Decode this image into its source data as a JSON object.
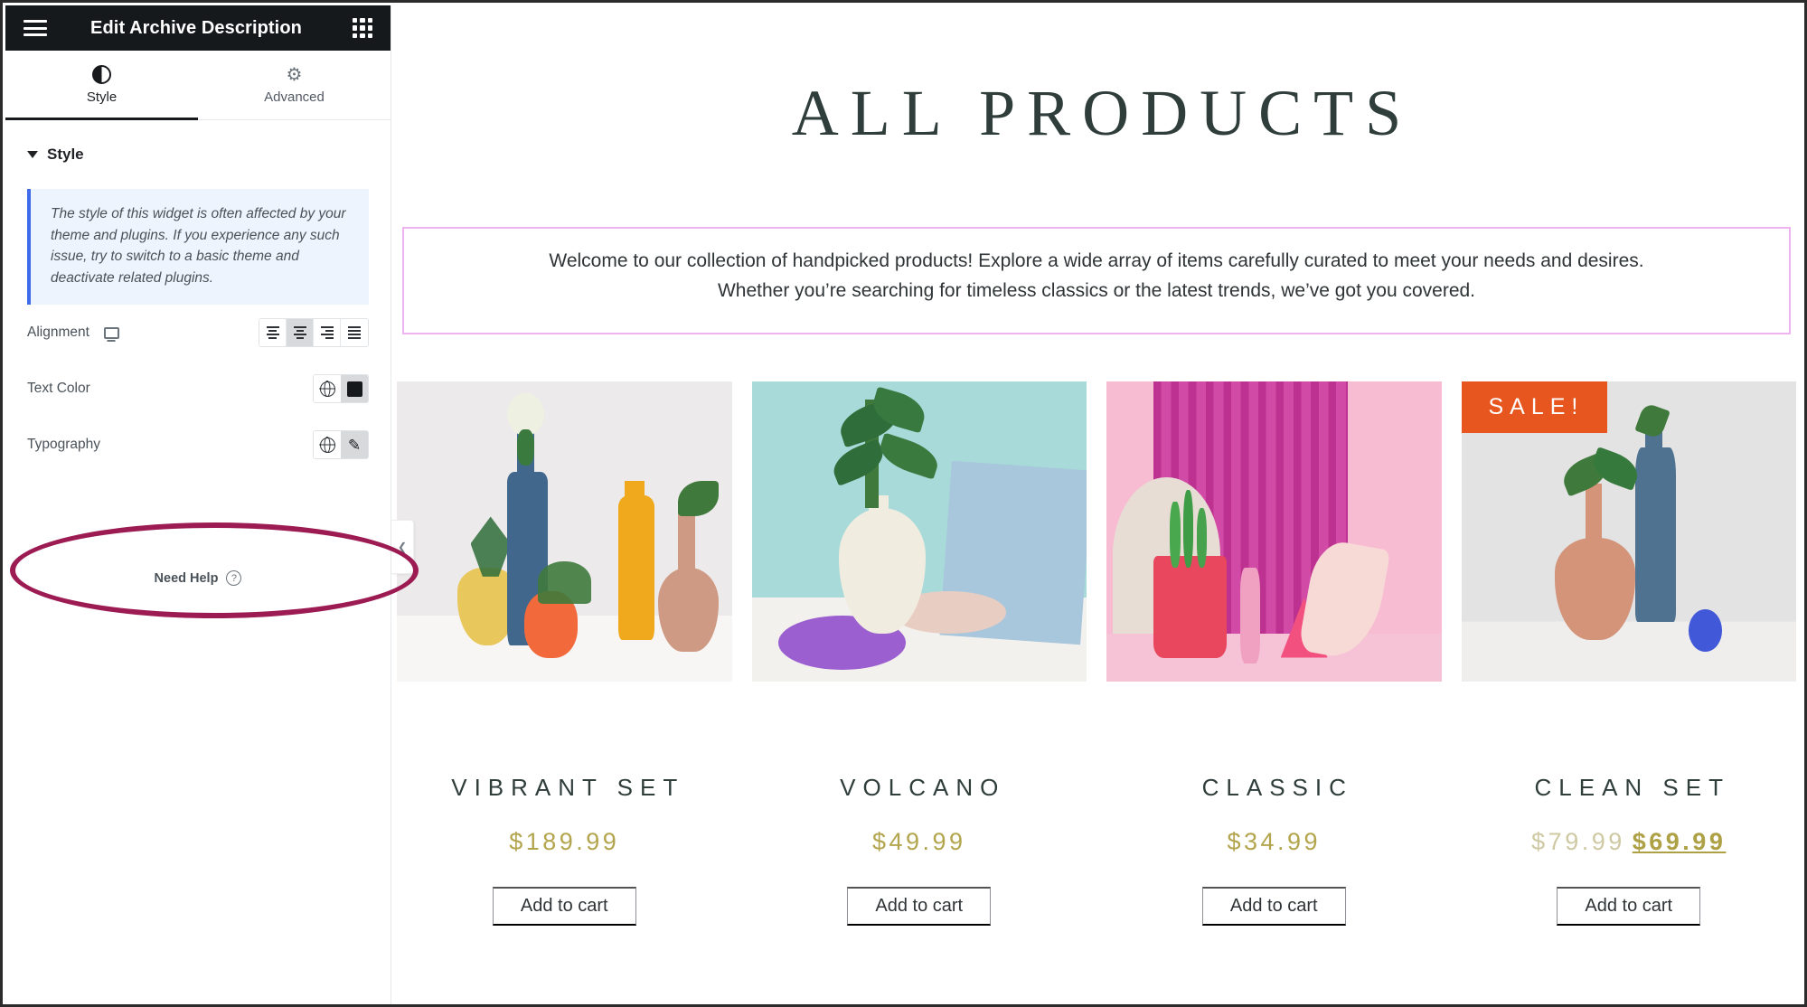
{
  "panel": {
    "header": {
      "title": "Edit Archive Description",
      "menu_icon": "hamburger-icon",
      "apps_icon": "grid-apps-icon"
    },
    "tabs": [
      {
        "label": "Style",
        "icon": "contrast-icon",
        "active": true
      },
      {
        "label": "Advanced",
        "icon": "gear-icon",
        "active": false
      }
    ],
    "section": {
      "title": "Style"
    },
    "notice": "The style of this widget is often affected by your theme and plugins. If you experience any such issue, try to switch to a basic theme and deactivate related plugins.",
    "controls": {
      "alignment": {
        "label": "Alignment",
        "device_icon": "monitor-icon",
        "options": [
          "align-left",
          "align-center",
          "align-right",
          "align-justify"
        ],
        "selected": "align-center"
      },
      "text_color": {
        "label": "Text Color",
        "globe_icon": "globe-icon",
        "swatch": "#16191c"
      },
      "typography": {
        "label": "Typography",
        "globe_icon": "globe-icon",
        "edit_icon": "pencil-icon"
      }
    },
    "need_help": {
      "label": "Need Help",
      "icon": "question-circle-icon"
    },
    "handle_icon": "collapse-arrow-icon",
    "annotation": {
      "shape": "ellipse",
      "color": "#9c1b52",
      "targets": "typography-row"
    }
  },
  "canvas": {
    "page_title": "ALL PRODUCTS",
    "archive_description": {
      "line1": "Welcome to our collection of handpicked products! Explore a wide array of items carefully curated to meet your needs and desires.",
      "line2": "Whether you’re searching for timeless classics or the latest trends, we’ve got you covered.",
      "border_color": "#efb3ef"
    },
    "add_to_cart_label": "Add to cart",
    "sale_badge": "SALE!",
    "price_color": "#b3a54e",
    "products": [
      {
        "name": "VIBRANT SET",
        "price": "$189.99",
        "on_sale": false,
        "image_alt": "colorful ceramic vases with plants on white background"
      },
      {
        "name": "VOLCANO",
        "price": "$49.99",
        "on_sale": false,
        "image_alt": "white teardrop vase with green leaves on teal background"
      },
      {
        "name": "CLASSIC",
        "price": "$34.99",
        "on_sale": false,
        "image_alt": "red pot with cactus on pink and magenta background"
      },
      {
        "name": "CLEAN SET",
        "price_old": "$79.99",
        "price": "$69.99",
        "on_sale": true,
        "image_alt": "terracotta and blue vases with blue ball on grey background"
      }
    ]
  }
}
